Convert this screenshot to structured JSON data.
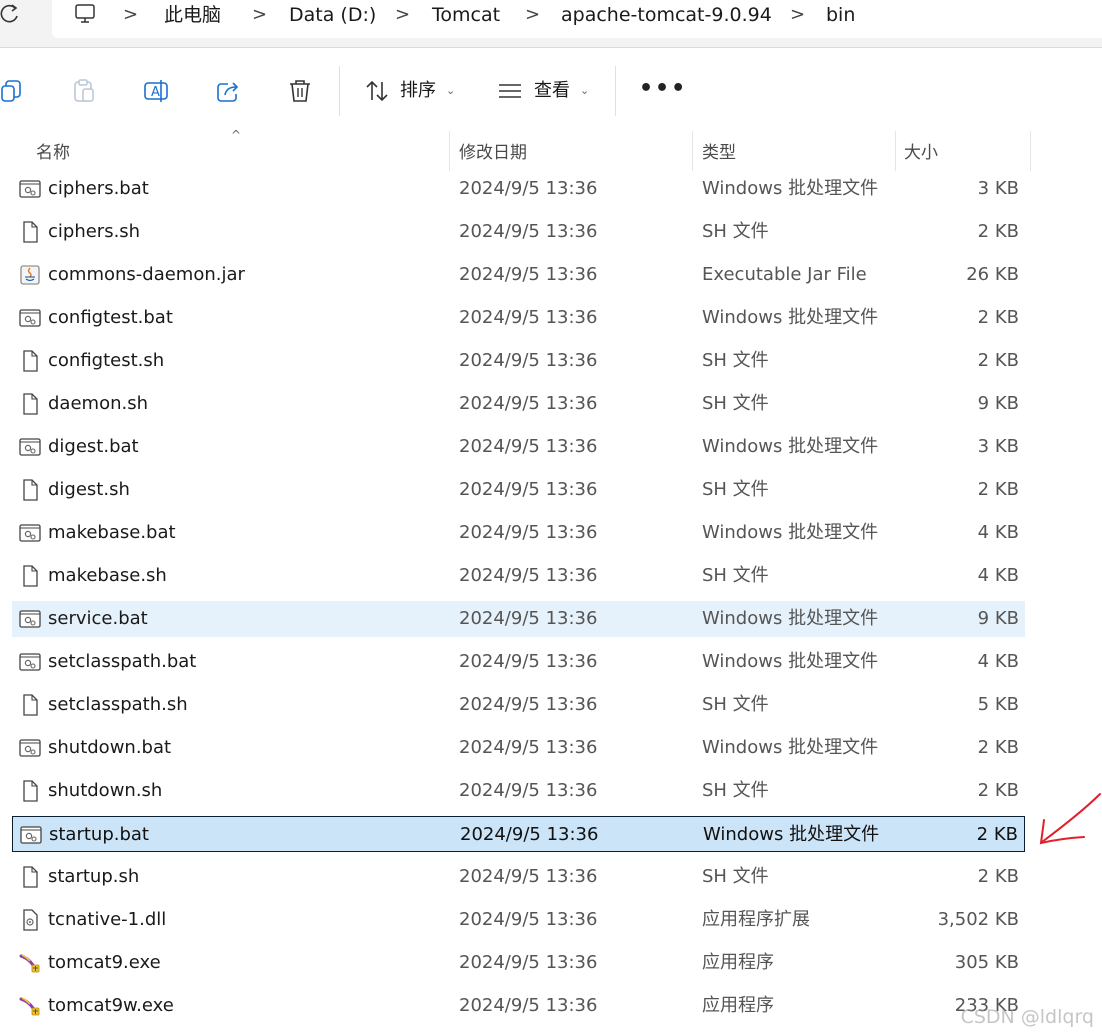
{
  "breadcrumb": [
    "此电脑",
    "Data (D:)",
    "Tomcat",
    "apache-tomcat-9.0.94",
    "bin"
  ],
  "toolbar": {
    "sort_label": "排序",
    "view_label": "查看",
    "more": "•••"
  },
  "columns": {
    "name": "名称",
    "date": "修改日期",
    "type": "类型",
    "size": "大小"
  },
  "files": [
    {
      "name": "ciphers.bat",
      "date": "2024/9/5 13:36",
      "type": "Windows 批处理文件",
      "size": "3 KB",
      "icon": "bat"
    },
    {
      "name": "ciphers.sh",
      "date": "2024/9/5 13:36",
      "type": "SH 文件",
      "size": "2 KB",
      "icon": "doc"
    },
    {
      "name": "commons-daemon.jar",
      "date": "2024/9/5 13:36",
      "type": "Executable Jar File",
      "size": "26 KB",
      "icon": "jar"
    },
    {
      "name": "configtest.bat",
      "date": "2024/9/5 13:36",
      "type": "Windows 批处理文件",
      "size": "2 KB",
      "icon": "bat"
    },
    {
      "name": "configtest.sh",
      "date": "2024/9/5 13:36",
      "type": "SH 文件",
      "size": "2 KB",
      "icon": "doc"
    },
    {
      "name": "daemon.sh",
      "date": "2024/9/5 13:36",
      "type": "SH 文件",
      "size": "9 KB",
      "icon": "doc"
    },
    {
      "name": "digest.bat",
      "date": "2024/9/5 13:36",
      "type": "Windows 批处理文件",
      "size": "3 KB",
      "icon": "bat"
    },
    {
      "name": "digest.sh",
      "date": "2024/9/5 13:36",
      "type": "SH 文件",
      "size": "2 KB",
      "icon": "doc"
    },
    {
      "name": "makebase.bat",
      "date": "2024/9/5 13:36",
      "type": "Windows 批处理文件",
      "size": "4 KB",
      "icon": "bat"
    },
    {
      "name": "makebase.sh",
      "date": "2024/9/5 13:36",
      "type": "SH 文件",
      "size": "4 KB",
      "icon": "doc"
    },
    {
      "name": "service.bat",
      "date": "2024/9/5 13:36",
      "type": "Windows 批处理文件",
      "size": "9 KB",
      "icon": "bat",
      "state": "hover"
    },
    {
      "name": "setclasspath.bat",
      "date": "2024/9/5 13:36",
      "type": "Windows 批处理文件",
      "size": "4 KB",
      "icon": "bat"
    },
    {
      "name": "setclasspath.sh",
      "date": "2024/9/5 13:36",
      "type": "SH 文件",
      "size": "5 KB",
      "icon": "doc"
    },
    {
      "name": "shutdown.bat",
      "date": "2024/9/5 13:36",
      "type": "Windows 批处理文件",
      "size": "2 KB",
      "icon": "bat"
    },
    {
      "name": "shutdown.sh",
      "date": "2024/9/5 13:36",
      "type": "SH 文件",
      "size": "2 KB",
      "icon": "doc"
    },
    {
      "name": "startup.bat",
      "date": "2024/9/5 13:36",
      "type": "Windows 批处理文件",
      "size": "2 KB",
      "icon": "bat",
      "state": "selected"
    },
    {
      "name": "startup.sh",
      "date": "2024/9/5 13:36",
      "type": "SH 文件",
      "size": "2 KB",
      "icon": "doc"
    },
    {
      "name": "tcnative-1.dll",
      "date": "2024/9/5 13:36",
      "type": "应用程序扩展",
      "size": "3,502 KB",
      "icon": "dll"
    },
    {
      "name": "tomcat9.exe",
      "date": "2024/9/5 13:36",
      "type": "应用程序",
      "size": "305 KB",
      "icon": "exe"
    },
    {
      "name": "tomcat9w.exe",
      "date": "2024/9/5 13:36",
      "type": "应用程序",
      "size": "233 KB",
      "icon": "exe"
    }
  ],
  "watermark": "CSDN @ldlqrq",
  "colors": {
    "hover": "#e6f2fb",
    "selected": "#cce4f7",
    "annotation_arrow": "#e0202a"
  }
}
